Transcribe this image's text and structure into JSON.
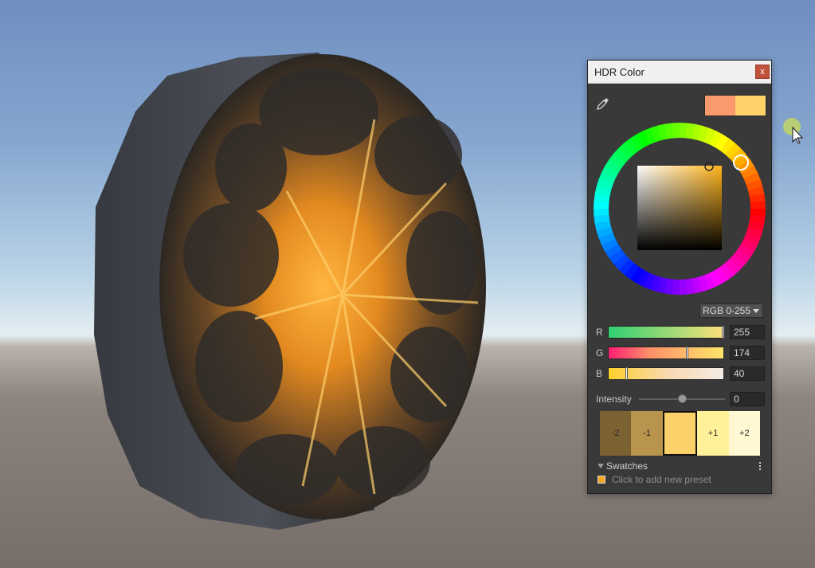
{
  "window": {
    "title": "HDR Color",
    "close_label": "x"
  },
  "preview": {
    "current_color": "#fa9a6c",
    "new_color": "#ffd26a"
  },
  "color_mode": {
    "selected": "RGB 0-255"
  },
  "channels": [
    {
      "label": "R",
      "value": "255",
      "fraction": 1.0
    },
    {
      "label": "G",
      "value": "174",
      "fraction": 0.682
    },
    {
      "label": "B",
      "value": "40",
      "fraction": 0.157
    }
  ],
  "intensity": {
    "label": "Intensity",
    "value": "0"
  },
  "exposure_swatches": [
    {
      "label": "-2",
      "color": "#7c6232"
    },
    {
      "label": "-1",
      "color": "#b8944c"
    },
    {
      "label": "",
      "color": "#fdd16a"
    },
    {
      "label": "+1",
      "color": "#fff19a"
    },
    {
      "label": "+2",
      "color": "#fff8d2"
    }
  ],
  "swatches": {
    "label": "Swatches",
    "add_preset": "Click to add new preset",
    "preset_color": "#f5a623"
  },
  "icons": {
    "eyedropper": "eyedropper-icon",
    "menu": "kebab-menu-icon",
    "pointer": "mouse-pointer-icon"
  }
}
